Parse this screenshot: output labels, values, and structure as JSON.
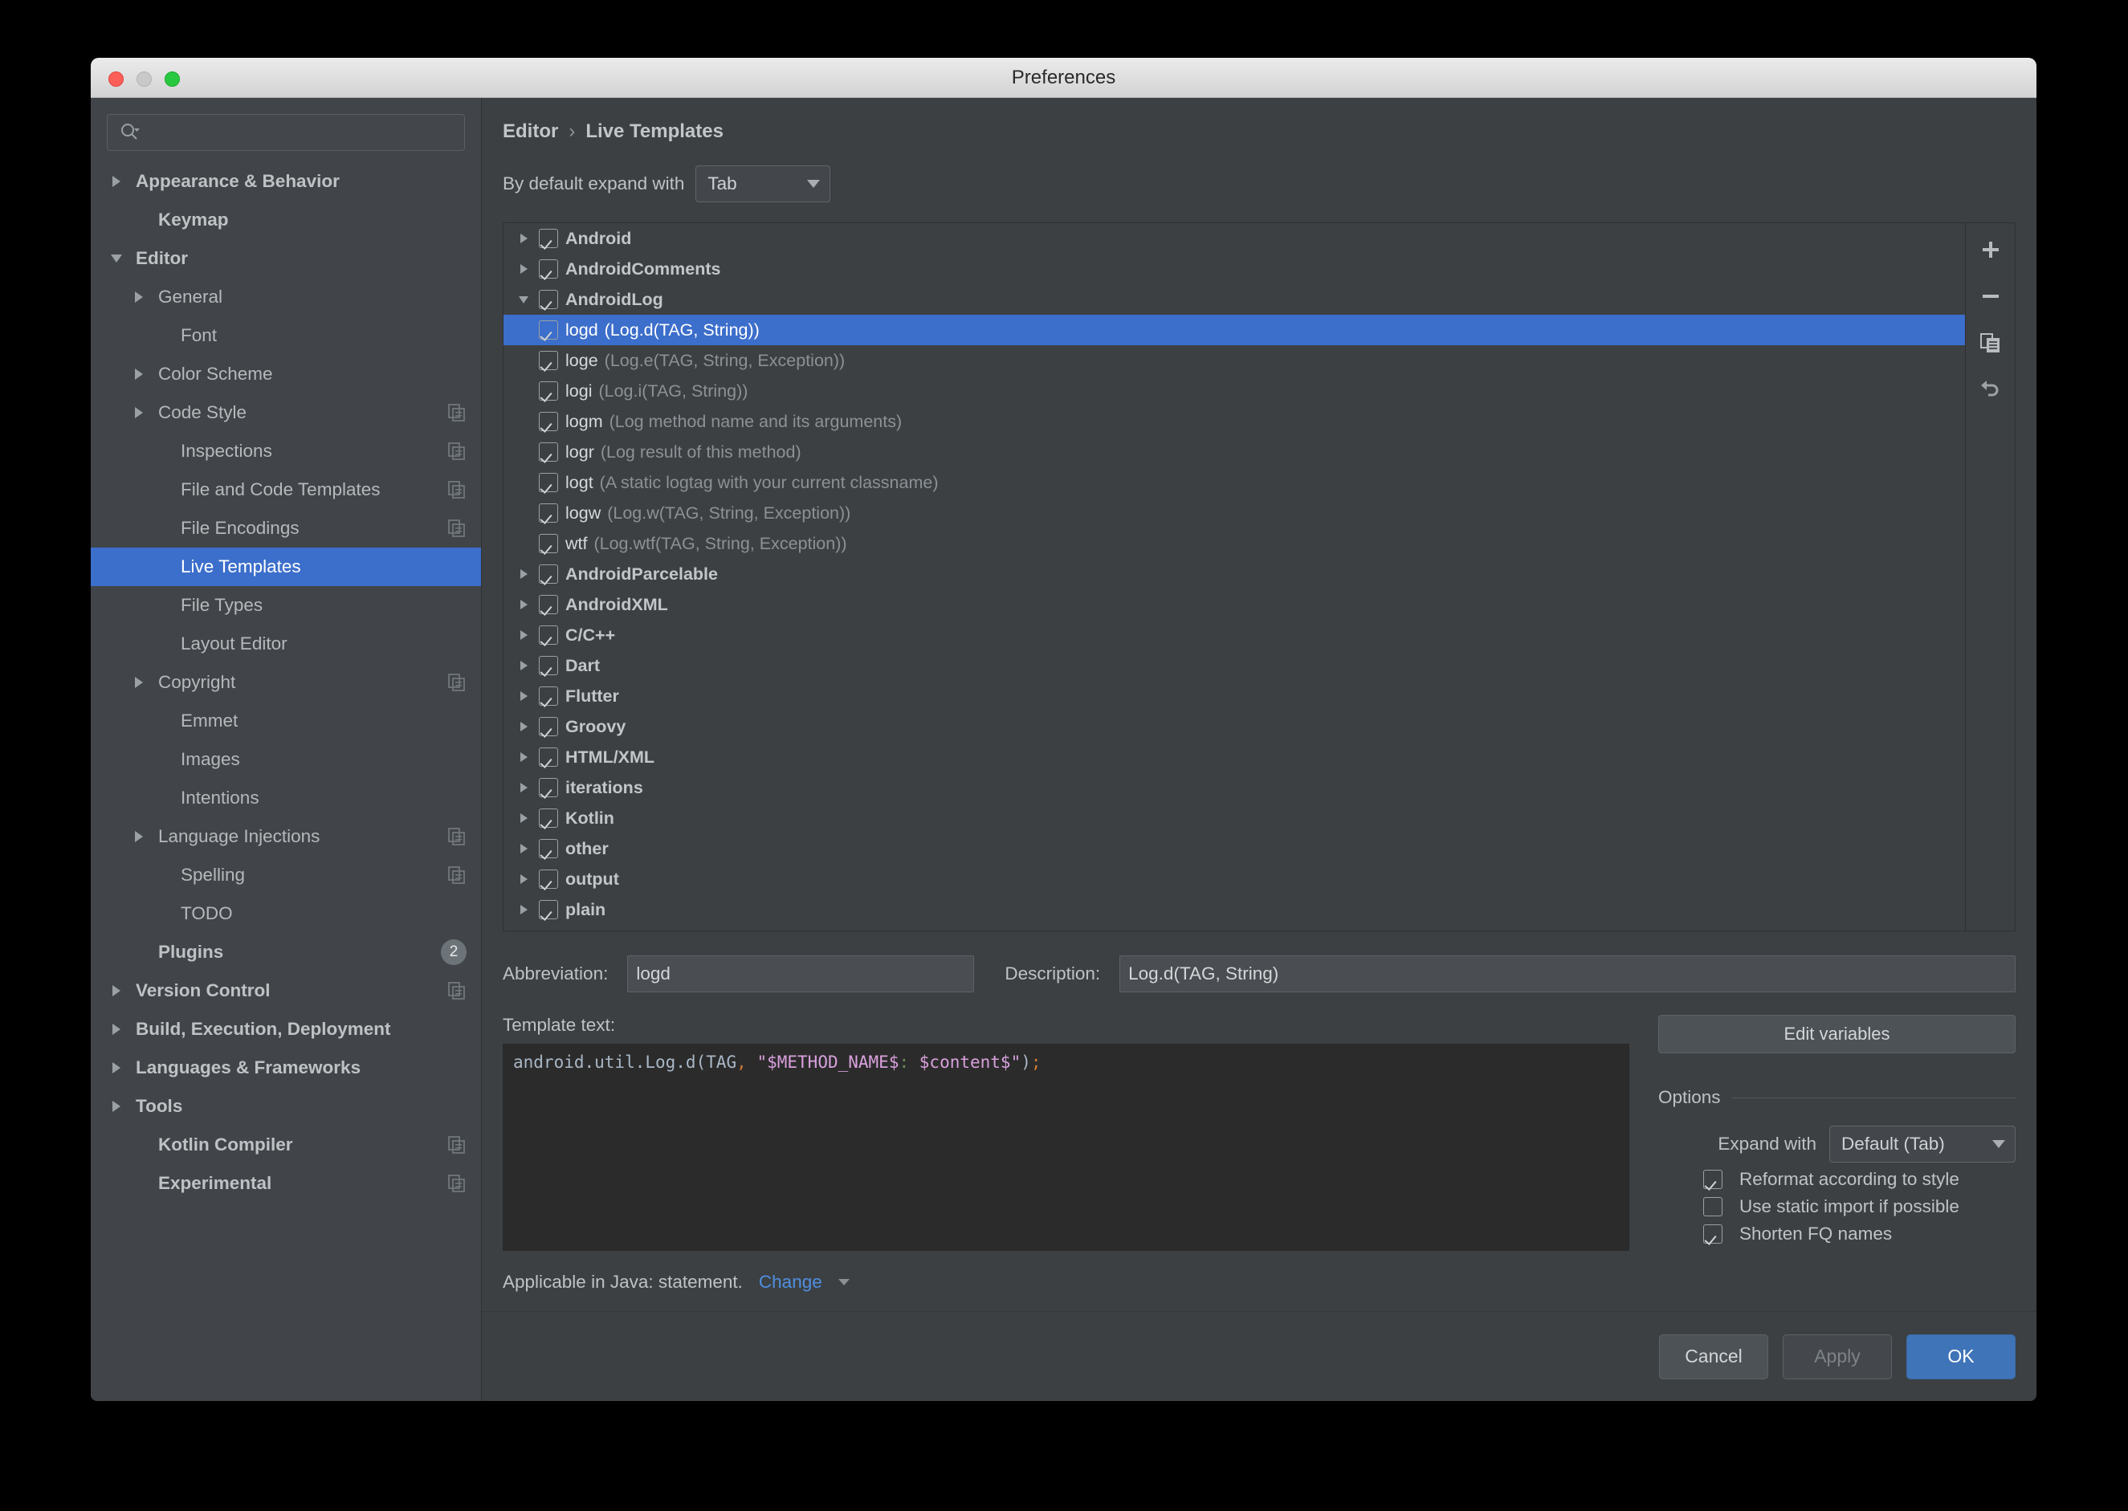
{
  "window": {
    "title": "Preferences"
  },
  "traffic": {
    "close": "close-button",
    "minimize": "minimize-button",
    "maximize": "maximize-button"
  },
  "search": {
    "placeholder": "",
    "value": "",
    "icon": "search-icon"
  },
  "sidebar": {
    "items": [
      {
        "label": "Appearance & Behavior",
        "indent": 0,
        "twisty": "right",
        "bold": true
      },
      {
        "label": "Keymap",
        "indent": 1,
        "twisty": "none",
        "bold": true
      },
      {
        "label": "Editor",
        "indent": 0,
        "twisty": "down",
        "bold": true
      },
      {
        "label": "General",
        "indent": 1,
        "twisty": "right",
        "bold": false
      },
      {
        "label": "Font",
        "indent": 2,
        "twisty": "none",
        "bold": false
      },
      {
        "label": "Color Scheme",
        "indent": 1,
        "twisty": "right",
        "bold": false
      },
      {
        "label": "Code Style",
        "indent": 1,
        "twisty": "right",
        "bold": false,
        "copy": true
      },
      {
        "label": "Inspections",
        "indent": 2,
        "twisty": "none",
        "bold": false,
        "copy": true
      },
      {
        "label": "File and Code Templates",
        "indent": 2,
        "twisty": "none",
        "bold": false,
        "copy": true
      },
      {
        "label": "File Encodings",
        "indent": 2,
        "twisty": "none",
        "bold": false,
        "copy": true
      },
      {
        "label": "Live Templates",
        "indent": 2,
        "twisty": "none",
        "bold": false,
        "selected": true
      },
      {
        "label": "File Types",
        "indent": 2,
        "twisty": "none",
        "bold": false
      },
      {
        "label": "Layout Editor",
        "indent": 2,
        "twisty": "none",
        "bold": false
      },
      {
        "label": "Copyright",
        "indent": 1,
        "twisty": "right",
        "bold": false,
        "copy": true
      },
      {
        "label": "Emmet",
        "indent": 2,
        "twisty": "none",
        "bold": false
      },
      {
        "label": "Images",
        "indent": 2,
        "twisty": "none",
        "bold": false
      },
      {
        "label": "Intentions",
        "indent": 2,
        "twisty": "none",
        "bold": false
      },
      {
        "label": "Language Injections",
        "indent": 1,
        "twisty": "right",
        "bold": false,
        "copy": true
      },
      {
        "label": "Spelling",
        "indent": 2,
        "twisty": "none",
        "bold": false,
        "copy": true
      },
      {
        "label": "TODO",
        "indent": 2,
        "twisty": "none",
        "bold": false
      },
      {
        "label": "Plugins",
        "indent": 1,
        "twisty": "none",
        "bold": true,
        "badge": "2"
      },
      {
        "label": "Version Control",
        "indent": 0,
        "twisty": "right",
        "bold": true,
        "copy": true
      },
      {
        "label": "Build, Execution, Deployment",
        "indent": 0,
        "twisty": "right",
        "bold": true
      },
      {
        "label": "Languages & Frameworks",
        "indent": 0,
        "twisty": "right",
        "bold": true
      },
      {
        "label": "Tools",
        "indent": 0,
        "twisty": "right",
        "bold": true
      },
      {
        "label": "Kotlin Compiler",
        "indent": 1,
        "twisty": "none",
        "bold": true,
        "copy": true
      },
      {
        "label": "Experimental",
        "indent": 1,
        "twisty": "none",
        "bold": true,
        "copy": true
      }
    ]
  },
  "breadcrumb": {
    "parent": "Editor",
    "separator": "›",
    "current": "Live Templates"
  },
  "expand_default": {
    "label": "By default expand with",
    "value": "Tab"
  },
  "tree": {
    "rows": [
      {
        "twisty": "right",
        "checked": true,
        "name": "Android",
        "desc": "",
        "group": true
      },
      {
        "twisty": "right",
        "checked": true,
        "name": "AndroidComments",
        "desc": "",
        "group": true
      },
      {
        "twisty": "down",
        "checked": true,
        "name": "AndroidLog",
        "desc": "",
        "group": true
      },
      {
        "twisty": "none",
        "checked": true,
        "name": "logd",
        "desc": "(Log.d(TAG, String))",
        "child": true,
        "selected": true
      },
      {
        "twisty": "none",
        "checked": true,
        "name": "loge",
        "desc": "(Log.e(TAG, String, Exception))",
        "child": true
      },
      {
        "twisty": "none",
        "checked": true,
        "name": "logi",
        "desc": "(Log.i(TAG, String))",
        "child": true
      },
      {
        "twisty": "none",
        "checked": true,
        "name": "logm",
        "desc": "(Log method name and its arguments)",
        "child": true
      },
      {
        "twisty": "none",
        "checked": true,
        "name": "logr",
        "desc": "(Log result of this method)",
        "child": true
      },
      {
        "twisty": "none",
        "checked": true,
        "name": "logt",
        "desc": "(A static logtag with your current classname)",
        "child": true
      },
      {
        "twisty": "none",
        "checked": true,
        "name": "logw",
        "desc": "(Log.w(TAG, String, Exception))",
        "child": true
      },
      {
        "twisty": "none",
        "checked": true,
        "name": "wtf",
        "desc": "(Log.wtf(TAG, String, Exception))",
        "child": true
      },
      {
        "twisty": "right",
        "checked": true,
        "name": "AndroidParcelable",
        "desc": "",
        "group": true
      },
      {
        "twisty": "right",
        "checked": true,
        "name": "AndroidXML",
        "desc": "",
        "group": true
      },
      {
        "twisty": "right",
        "checked": true,
        "name": "C/C++",
        "desc": "",
        "group": true
      },
      {
        "twisty": "right",
        "checked": true,
        "name": "Dart",
        "desc": "",
        "group": true
      },
      {
        "twisty": "right",
        "checked": true,
        "name": "Flutter",
        "desc": "",
        "group": true
      },
      {
        "twisty": "right",
        "checked": true,
        "name": "Groovy",
        "desc": "",
        "group": true
      },
      {
        "twisty": "right",
        "checked": true,
        "name": "HTML/XML",
        "desc": "",
        "group": true
      },
      {
        "twisty": "right",
        "checked": true,
        "name": "iterations",
        "desc": "",
        "group": true
      },
      {
        "twisty": "right",
        "checked": true,
        "name": "Kotlin",
        "desc": "",
        "group": true
      },
      {
        "twisty": "right",
        "checked": true,
        "name": "other",
        "desc": "",
        "group": true
      },
      {
        "twisty": "right",
        "checked": true,
        "name": "output",
        "desc": "",
        "group": true
      },
      {
        "twisty": "right",
        "checked": true,
        "name": "plain",
        "desc": "",
        "group": true
      }
    ],
    "tools": [
      {
        "icon": "plus-icon",
        "glyph": "+"
      },
      {
        "icon": "minus-icon",
        "glyph": "−"
      },
      {
        "icon": "copy-icon",
        "glyph": ""
      },
      {
        "icon": "revert-icon",
        "glyph": ""
      }
    ]
  },
  "form": {
    "abbreviation_label": "Abbreviation:",
    "abbreviation_value": "logd",
    "description_label": "Description:",
    "description_value": "Log.d(TAG, String)",
    "template_text_label": "Template text:",
    "code_segments": [
      {
        "text": "android.util.Log.d(TAG",
        "cls": "c-plain"
      },
      {
        "text": ",",
        "cls": "c-punct"
      },
      {
        "text": " ",
        "cls": "c-plain"
      },
      {
        "text": "\"$METHOD_NAME$",
        "cls": "c-var"
      },
      {
        "text": ":",
        "cls": "c-green"
      },
      {
        "text": " $content$\"",
        "cls": "c-var"
      },
      {
        "text": ")",
        "cls": "c-plain"
      },
      {
        "text": ";",
        "cls": "c-punct"
      }
    ]
  },
  "options": {
    "edit_variables_label": "Edit variables",
    "title": "Options",
    "expand_with_label": "Expand with",
    "expand_with_value": "Default (Tab)",
    "checks": [
      {
        "label": "Reformat according to style",
        "checked": true
      },
      {
        "label": "Use static import if possible",
        "checked": false
      },
      {
        "label": "Shorten FQ names",
        "checked": true
      }
    ]
  },
  "applicable": {
    "text": "Applicable in Java: statement.",
    "change_label": "Change"
  },
  "footer": {
    "help_label": "?",
    "cancel_label": "Cancel",
    "apply_label": "Apply",
    "ok_label": "OK"
  },
  "colors": {
    "accent_selection": "#3c6ecb",
    "primary_button": "#3f74b8",
    "link": "#4f8fe0",
    "window_bg": "#3c4043",
    "sidebar_bg": "#414549",
    "code_bg": "#2b2b2b"
  }
}
